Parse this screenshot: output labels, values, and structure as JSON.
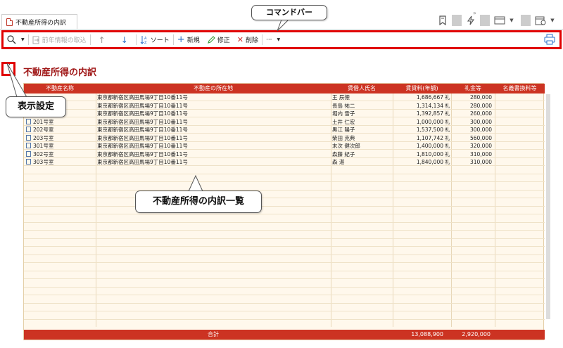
{
  "tab": {
    "title": "不動産所得の内訳"
  },
  "commandbar": {
    "import_label": "前年情報の取込",
    "sort_label": "ソート",
    "new_label": "新規",
    "edit_label": "修正",
    "delete_label": "削除",
    "more_label": "···"
  },
  "page_title": "不動産所得の内訳",
  "table": {
    "headers": [
      "不動産名称",
      "不動産の所在地",
      "賃借人氏名",
      "賃貸料(年額)",
      "礼金等",
      "名義書換料等"
    ],
    "rows": [
      {
        "name": "",
        "address": "東京都新宿区高田馬場9丁目10番11号",
        "tenant": "王 辰徳",
        "rent": "1,686,667",
        "rent_unit": "礼",
        "key": "280,000",
        "fee": ""
      },
      {
        "name": "",
        "address": "東京都新宿区高田馬場9丁目10番11号",
        "tenant": "長島 祐二",
        "rent": "1,314,134",
        "rent_unit": "礼",
        "key": "280,000",
        "fee": ""
      },
      {
        "name": "",
        "address": "東京都新宿区高田馬場9丁目10番11号",
        "tenant": "堀内 雪子",
        "rent": "1,392,857",
        "rent_unit": "礼",
        "key": "260,000",
        "fee": ""
      },
      {
        "name": "201号室",
        "address": "東京都新宿区高田馬場9丁目10番11号",
        "tenant": "土井 仁宏",
        "rent": "1,000,000",
        "rent_unit": "礼",
        "key": "300,000",
        "fee": ""
      },
      {
        "name": "202号室",
        "address": "東京都新宿区高田馬場9丁目10番11号",
        "tenant": "黒江 陽子",
        "rent": "1,537,500",
        "rent_unit": "礼",
        "key": "300,000",
        "fee": ""
      },
      {
        "name": "203号室",
        "address": "東京都新宿区高田馬場9丁目10番11号",
        "tenant": "柴田 克典",
        "rent": "1,107,742",
        "rent_unit": "礼",
        "key": "560,000",
        "fee": ""
      },
      {
        "name": "301号室",
        "address": "東京都新宿区高田馬場9丁目10番11号",
        "tenant": "末次 健次郎",
        "rent": "1,400,000",
        "rent_unit": "礼",
        "key": "320,000",
        "fee": ""
      },
      {
        "name": "302号室",
        "address": "東京都新宿区高田馬場9丁目10番11号",
        "tenant": "森藤 紀子",
        "rent": "1,810,000",
        "rent_unit": "礼",
        "key": "310,000",
        "fee": ""
      },
      {
        "name": "303号室",
        "address": "東京都新宿区高田馬場9丁目10番11号",
        "tenant": "森 湛",
        "rent": "1,840,000",
        "rent_unit": "礼",
        "key": "310,000",
        "fee": ""
      }
    ],
    "footer": {
      "label": "合計",
      "rent_total": "13,088,900",
      "key_total": "2,920,000"
    }
  },
  "callouts": {
    "commandbar": "コマンドバー",
    "display_settings": "表示設定",
    "list": "不動産所得の内訳一覧"
  },
  "colors": {
    "accent": "#cc3322",
    "highlight_red": "#e00000",
    "table_bg": "#fff8ec"
  }
}
